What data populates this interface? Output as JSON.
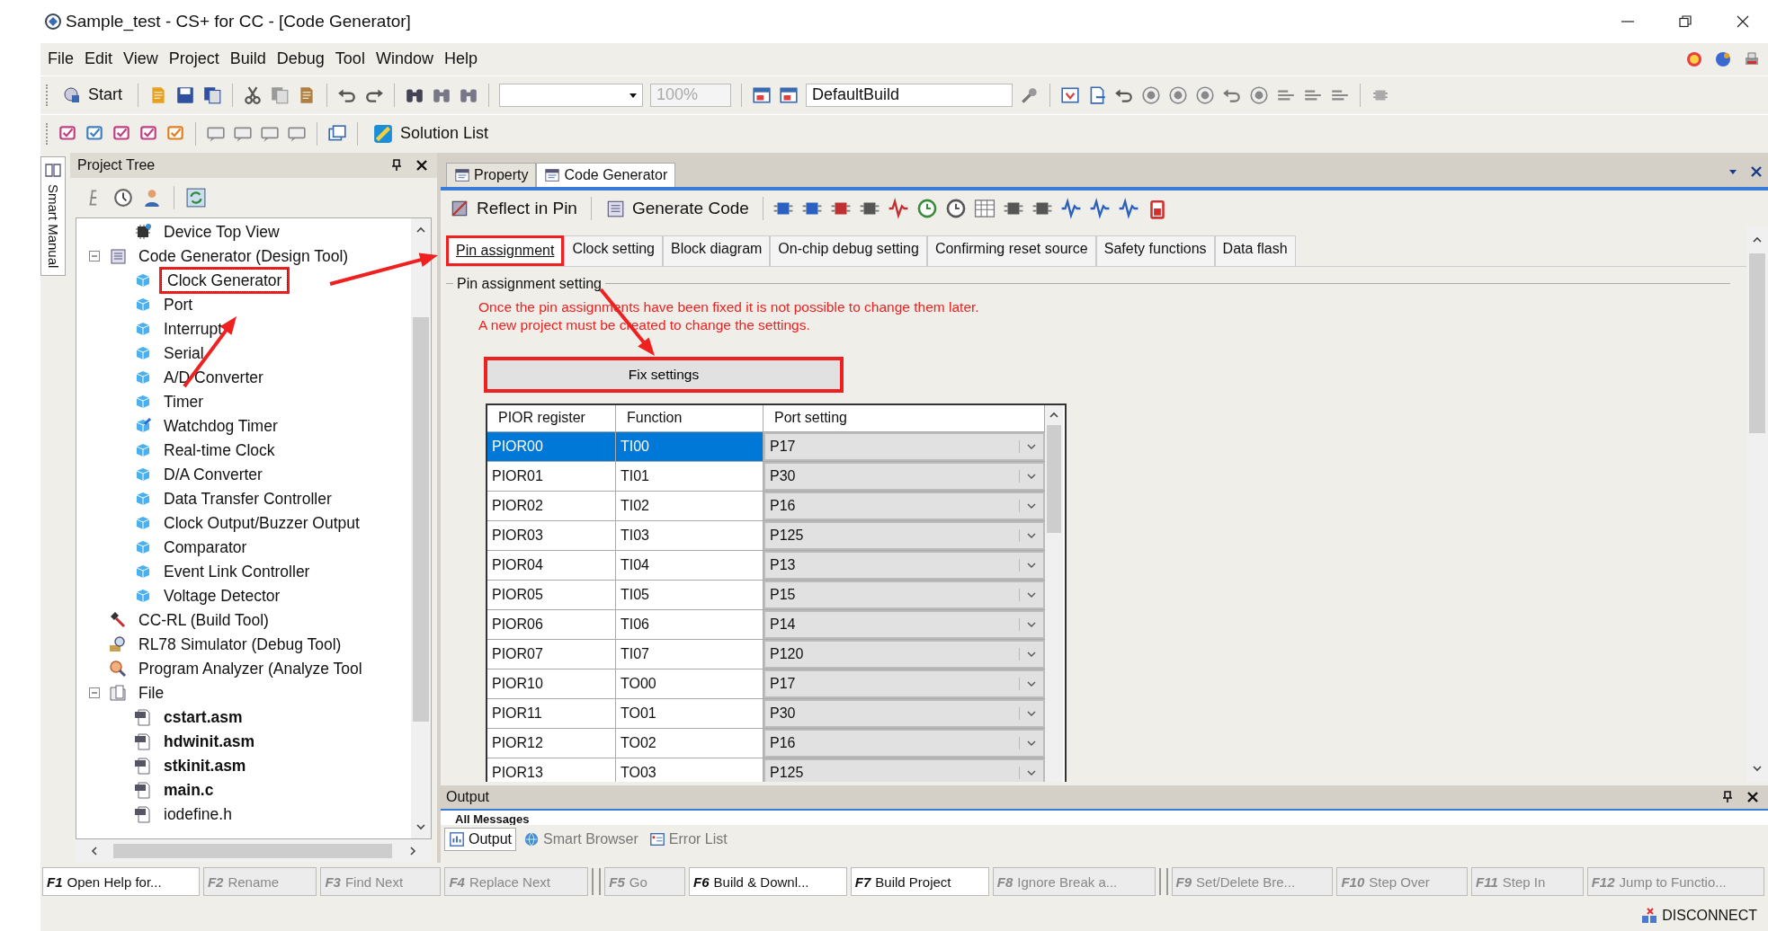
{
  "window": {
    "title": "Sample_test - CS+ for CC - [Code Generator]"
  },
  "menu": [
    "File",
    "Edit",
    "View",
    "Project",
    "Build",
    "Debug",
    "Tool",
    "Window",
    "Help"
  ],
  "toolbar": {
    "start_label": "Start",
    "zoom_combo": {
      "value": "100%",
      "disabled": true
    },
    "build_combo": {
      "value": "DefaultBuild",
      "disabled": false
    },
    "solution_list_label": "Solution List"
  },
  "side_tab": {
    "label": "Smart Manual"
  },
  "project_tree": {
    "title": "Project Tree",
    "nodes": [
      {
        "children": [
          {
            "label": "Device Top View",
            "kind": "device",
            "selected": false,
            "highlighted": false,
            "bold": false
          }
        ]
      },
      {
        "label": "Code Generator (Design Tool)",
        "kind": "codegen",
        "expanded": true,
        "selected": false,
        "highlighted": false,
        "bold": false,
        "children": [
          {
            "label": "Clock Generator",
            "kind": "module",
            "selected": true,
            "highlighted": true,
            "bold": false
          },
          {
            "label": "Port",
            "kind": "module",
            "selected": false,
            "highlighted": false,
            "bold": false
          },
          {
            "label": "Interrupt",
            "kind": "module",
            "selected": false,
            "highlighted": false,
            "bold": false
          },
          {
            "label": "Serial",
            "kind": "module",
            "selected": false,
            "highlighted": false,
            "bold": false
          },
          {
            "label": "A/D Converter",
            "kind": "module",
            "selected": false,
            "highlighted": false,
            "bold": false
          },
          {
            "label": "Timer",
            "kind": "module",
            "selected": false,
            "highlighted": false,
            "bold": false
          },
          {
            "label": "Watchdog Timer",
            "kind": "module-edit",
            "selected": false,
            "highlighted": false,
            "bold": false
          },
          {
            "label": "Real-time Clock",
            "kind": "module",
            "selected": false,
            "highlighted": false,
            "bold": false
          },
          {
            "label": "D/A Converter",
            "kind": "module",
            "selected": false,
            "highlighted": false,
            "bold": false
          },
          {
            "label": "Data Transfer Controller",
            "kind": "module",
            "selected": false,
            "highlighted": false,
            "bold": false
          },
          {
            "label": "Clock Output/Buzzer Output",
            "kind": "module",
            "selected": false,
            "highlighted": false,
            "bold": false
          },
          {
            "label": "Comparator",
            "kind": "module",
            "selected": false,
            "highlighted": false,
            "bold": false
          },
          {
            "label": "Event Link Controller",
            "kind": "module",
            "selected": false,
            "highlighted": false,
            "bold": false
          },
          {
            "label": "Voltage Detector",
            "kind": "module",
            "selected": false,
            "highlighted": false,
            "bold": false
          }
        ]
      },
      {
        "label": "CC-RL (Build Tool)",
        "kind": "build",
        "selected": false,
        "highlighted": false,
        "bold": false
      },
      {
        "label": "RL78 Simulator (Debug Tool)",
        "kind": "debug",
        "selected": false,
        "highlighted": false,
        "bold": false
      },
      {
        "label": "Program Analyzer (Analyze Tool",
        "kind": "analyzer",
        "selected": false,
        "highlighted": false,
        "bold": false
      },
      {
        "label": "File",
        "kind": "folder",
        "expanded": true,
        "selected": false,
        "highlighted": false,
        "bold": false,
        "children": [
          {
            "label": "cstart.asm",
            "kind": "asm",
            "selected": false,
            "highlighted": false,
            "bold": true
          },
          {
            "label": "hdwinit.asm",
            "kind": "asm",
            "selected": false,
            "highlighted": false,
            "bold": true
          },
          {
            "label": "stkinit.asm",
            "kind": "asm",
            "selected": false,
            "highlighted": false,
            "bold": true
          },
          {
            "label": "main.c",
            "kind": "c",
            "selected": false,
            "highlighted": false,
            "bold": true
          },
          {
            "label": "iodefine.h",
            "kind": "h",
            "selected": false,
            "highlighted": false,
            "bold": false
          }
        ]
      }
    ]
  },
  "code_generator": {
    "panel_tabs": [
      {
        "label": "Property",
        "selected": false
      },
      {
        "label": "Code Generator",
        "selected": true
      }
    ],
    "toolbar": [
      "Reflect in Pin",
      "Generate Code"
    ],
    "tabs": [
      {
        "label": "Pin assignment",
        "selected": true,
        "highlighted": true
      },
      {
        "label": "Clock setting",
        "selected": false,
        "highlighted": false
      },
      {
        "label": "Block diagram",
        "selected": false,
        "highlighted": false
      },
      {
        "label": "On-chip debug setting",
        "selected": false,
        "highlighted": false
      },
      {
        "label": "Confirming reset source",
        "selected": false,
        "highlighted": false
      },
      {
        "label": "Safety functions",
        "selected": false,
        "highlighted": false
      },
      {
        "label": "Data flash",
        "selected": false,
        "highlighted": false
      }
    ],
    "group_label": "Pin assignment setting",
    "warning": [
      "Once the pin assignments have been fixed it is not possible to change them later.",
      "A new project must be created to change the settings."
    ],
    "fix_button": {
      "label": "Fix settings",
      "highlighted": true
    },
    "table": {
      "columns": [
        "PIOR register",
        "Function",
        "Port setting"
      ],
      "rows": [
        {
          "register": "PIOR00",
          "function": "TI00",
          "port": "P17",
          "selected": true
        },
        {
          "register": "PIOR01",
          "function": "TI01",
          "port": "P30",
          "selected": false
        },
        {
          "register": "PIOR02",
          "function": "TI02",
          "port": "P16",
          "selected": false
        },
        {
          "register": "PIOR03",
          "function": "TI03",
          "port": "P125",
          "selected": false
        },
        {
          "register": "PIOR04",
          "function": "TI04",
          "port": "P13",
          "selected": false
        },
        {
          "register": "PIOR05",
          "function": "TI05",
          "port": "P15",
          "selected": false
        },
        {
          "register": "PIOR06",
          "function": "TI06",
          "port": "P14",
          "selected": false
        },
        {
          "register": "PIOR07",
          "function": "TI07",
          "port": "P120",
          "selected": false
        },
        {
          "register": "PIOR10",
          "function": "TO00",
          "port": "P17",
          "selected": false
        },
        {
          "register": "PIOR11",
          "function": "TO01",
          "port": "P30",
          "selected": false
        },
        {
          "register": "PIOR12",
          "function": "TO02",
          "port": "P16",
          "selected": false
        },
        {
          "register": "PIOR13",
          "function": "TO03",
          "port": "P125",
          "selected": false
        }
      ]
    }
  },
  "output": {
    "title": "Output",
    "tab": "All Messages",
    "bottom_tabs": [
      {
        "label": "Output",
        "selected": true
      },
      {
        "label": "Smart Browser",
        "selected": false
      },
      {
        "label": "Error List",
        "selected": false
      }
    ]
  },
  "function_keys": [
    {
      "key": "F1",
      "label": "Open Help for...",
      "enabled": true
    },
    {
      "key": "F2",
      "label": "Rename",
      "enabled": false
    },
    {
      "key": "F3",
      "label": "Find Next",
      "enabled": false
    },
    {
      "key": "F4",
      "label": "Replace Next",
      "enabled": false
    },
    {
      "key": "F5",
      "label": "Go",
      "enabled": false
    },
    {
      "key": "F6",
      "label": "Build & Downl...",
      "enabled": true
    },
    {
      "key": "F7",
      "label": "Build Project",
      "enabled": true
    },
    {
      "key": "F8",
      "label": "Ignore Break a...",
      "enabled": false
    },
    {
      "key": "F9",
      "label": "Set/Delete Bre...",
      "enabled": false
    },
    {
      "key": "F10",
      "label": "Step Over",
      "enabled": false
    },
    {
      "key": "F11",
      "label": "Step In",
      "enabled": false
    },
    {
      "key": "F12",
      "label": "Jump to Functio...",
      "enabled": false
    }
  ],
  "status": {
    "connection": "DISCONNECT"
  },
  "annotations": [
    {
      "kind": "arrow"
    },
    {
      "kind": "arrow"
    },
    {
      "kind": "arrow"
    }
  ]
}
